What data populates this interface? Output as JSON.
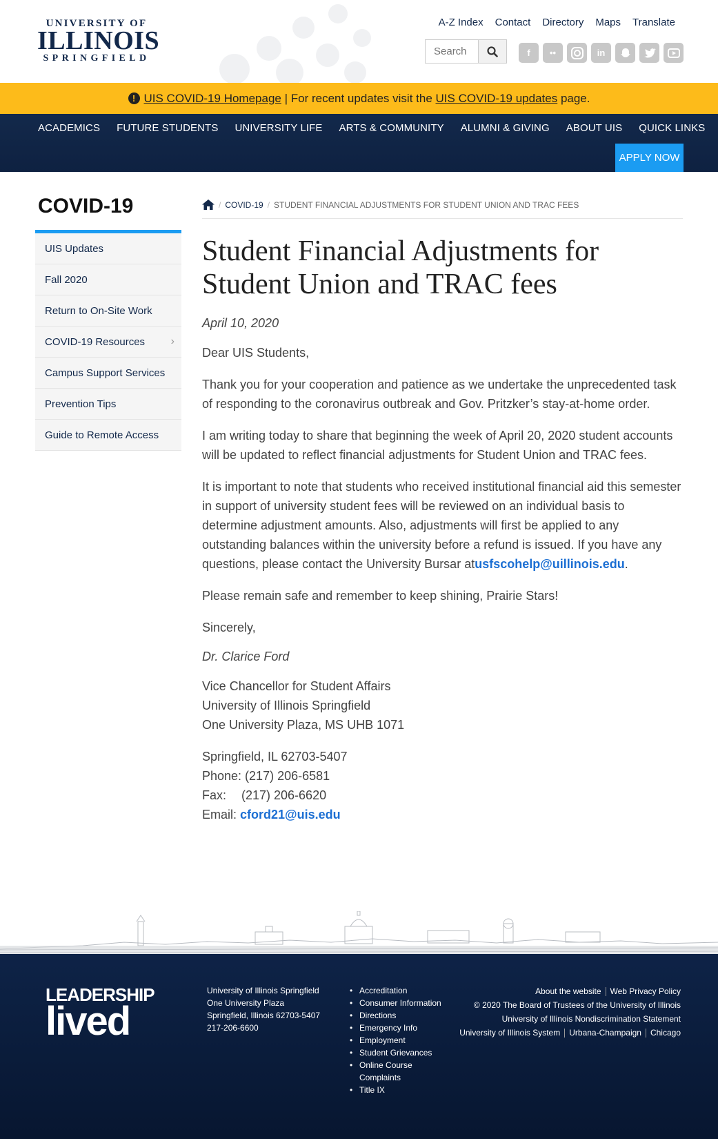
{
  "header": {
    "logo": {
      "line1": "UNIVERSITY OF",
      "line2": "ILLINOIS",
      "line3": "SPRINGFIELD"
    },
    "util_links": [
      "A-Z Index",
      "Contact",
      "Directory",
      "Maps",
      "Translate"
    ],
    "search": {
      "placeholder": "Search"
    },
    "social": [
      "facebook-icon",
      "flickr-icon",
      "instagram-icon",
      "linkedin-icon",
      "snapchat-icon",
      "twitter-icon",
      "youtube-icon"
    ]
  },
  "banner": {
    "link1": "UIS COVID-19 Homepage",
    "middle": " | For recent updates visit the ",
    "link2": "UIS COVID-19 updates",
    "end": " page."
  },
  "nav": {
    "items": [
      "ACADEMICS",
      "FUTURE STUDENTS",
      "UNIVERSITY LIFE",
      "ARTS & COMMUNITY",
      "ALUMNI & GIVING",
      "ABOUT UIS",
      "QUICK LINKS"
    ],
    "apply": "APPLY NOW"
  },
  "sidebar": {
    "title": "COVID-19",
    "items": [
      "UIS Updates",
      "Fall 2020",
      "Return to On-Site Work",
      "COVID-19 Resources",
      "Campus Support Services",
      "Prevention Tips",
      "Guide to Remote Access"
    ]
  },
  "breadcrumb": {
    "section": "COVID-19",
    "current": "STUDENT FINANCIAL ADJUSTMENTS FOR STUDENT UNION AND TRAC FEES"
  },
  "article": {
    "title": "Student Financial Adjustments for Student Union and TRAC fees",
    "date": "April 10, 2020",
    "greeting": "Dear UIS Students,",
    "p1": "Thank you for your cooperation and patience as we undertake the unprecedented task of responding to the coronavirus outbreak and Gov. Pritzker’s stay-at-home order.",
    "p2": "I am writing today to share that beginning the week of April 20, 2020 student accounts will be updated to reflect financial adjustments for Student Union and TRAC fees.",
    "p3": "It is important to note that students who received institutional financial aid this semester in support of university student fees will be reviewed on an individual basis to determine adjustment amounts. Also, adjustments will first be applied to any outstanding balances within the university before a refund is issued. If you have any questions, please contact the University Bursar at",
    "p3_email": "usfscohelp@uillinois.edu",
    "p3_end": ".",
    "p4": "Please remain safe and remember to keep shining, Prairie Stars!",
    "closing": "Sincerely,",
    "signer": "Dr. Clarice Ford",
    "sig_title": "Vice Chancellor for Student Affairs",
    "sig_org": "University of Illinois Springfield",
    "sig_addr": "One University Plaza, MS UHB 1071",
    "city": "Springfield, IL 62703-5407",
    "phone": "Phone: (217) 206-6581",
    "fax_label": "Fax:",
    "fax": "(217) 206-6620",
    "email_label": "Email: ",
    "email": "cford21@uis.edu"
  },
  "footer": {
    "brand_line1": "LEADERSHIP",
    "brand_line2": "lived",
    "address": [
      "University of Illinois Springfield",
      "One University Plaza",
      "Springfield, Illinois 62703-5407",
      "217-206-6600"
    ],
    "links": [
      "Accreditation",
      "Consumer Information",
      "Directions",
      "Emergency Info",
      "Employment",
      "Student Grievances",
      "Online Course Complaints",
      "Title IX"
    ],
    "about": "About the website",
    "privacy": "Web Privacy Policy",
    "copyright": "© 2020 The Board of Trustees of the University of Illinois",
    "nondiscrimination": "University of Illinois Nondiscrimination Statement",
    "system": "University of Illinois System",
    "urbana": "Urbana-Champaign",
    "chicago": "Chicago"
  },
  "colors": {
    "navy": "#13294b",
    "banner": "#fdbb1a",
    "accent": "#1b9cf2",
    "link": "#1c6fd3"
  }
}
